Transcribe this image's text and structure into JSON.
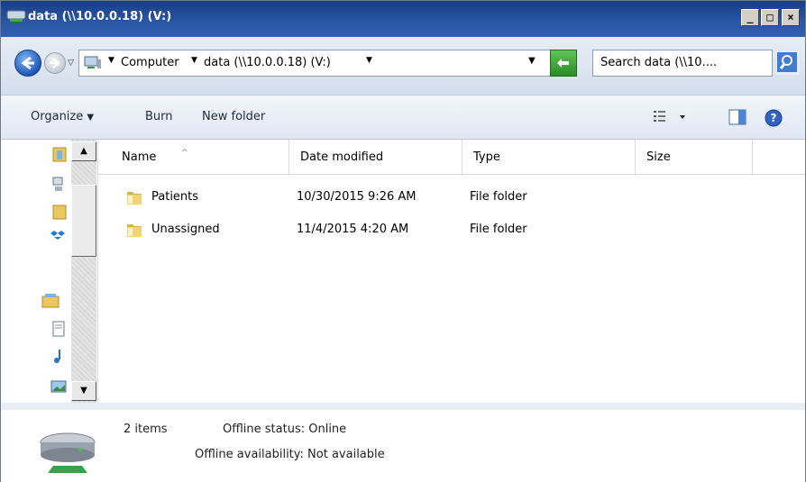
{
  "window": {
    "title": "data (\\\\10.0.0.18) (V:)",
    "caption_buttons": [
      "_",
      "□",
      "×"
    ]
  },
  "address": {
    "crumbs": [
      "Computer",
      "data (\\\\10.0.0.18) (V:)"
    ],
    "search_placeholder": "Search data (\\\\10...."
  },
  "commands": {
    "organize": "Organize",
    "burn": "Burn",
    "new_folder": "New folder"
  },
  "columns": {
    "name": "Name",
    "date": "Date modified",
    "type": "Type",
    "size": "Size"
  },
  "files": [
    {
      "name": "Patients",
      "date": "10/30/2015 9:26 AM",
      "type": "File folder",
      "size": ""
    },
    {
      "name": "Unassigned",
      "date": "11/4/2015 4:20 AM",
      "type": "File folder",
      "size": ""
    }
  ],
  "details": {
    "count": "2 items",
    "offline_status": "Offline status: Online",
    "offline_availability": "Offline availability: Not available"
  },
  "colors": {
    "titlebar": "#2957a6",
    "folder": "#e9c860"
  }
}
